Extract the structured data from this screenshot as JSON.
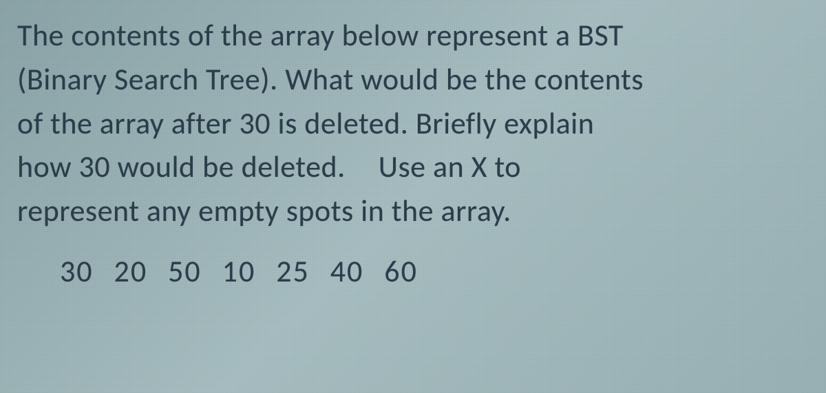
{
  "question": {
    "line1": "The contents of the array below represent a BST",
    "line2": "(Binary Search Tree). What would be the contents",
    "line3": "of the array after 30 is deleted. Briefly explain",
    "line4a": "how 30 would be deleted.",
    "line4b": "Use an X to",
    "line5": "represent any empty spots in the array."
  },
  "array_values": "30 20 50 10 25 40 60"
}
